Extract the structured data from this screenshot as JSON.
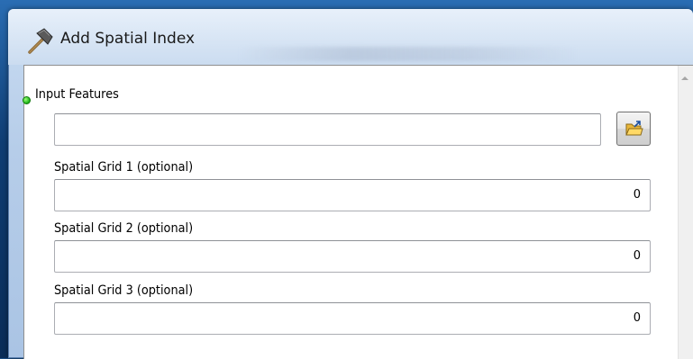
{
  "window": {
    "title": "Add Spatial Index",
    "icon": "hammer-icon"
  },
  "form": {
    "input_features": {
      "label": "Input Features",
      "value": "",
      "required_indicator_color": "#19b014"
    },
    "browse_button": {
      "icon": "open-folder-icon"
    },
    "spatial_grid_1": {
      "label": "Spatial Grid 1 (optional)",
      "value": "0"
    },
    "spatial_grid_2": {
      "label": "Spatial Grid 2 (optional)",
      "value": "0"
    },
    "spatial_grid_3": {
      "label": "Spatial Grid 3 (optional)",
      "value": "0"
    }
  }
}
